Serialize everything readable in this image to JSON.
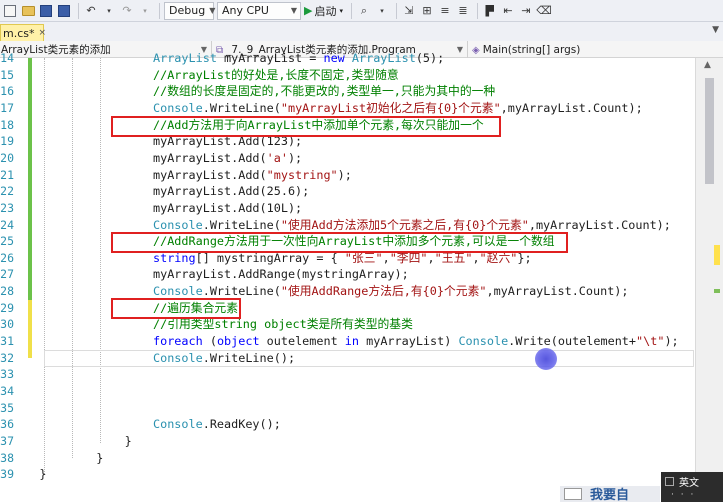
{
  "toolbar": {
    "config": "Debug",
    "platform": "Any CPU",
    "start_label": "启动"
  },
  "tab": {
    "label": "m.cs*",
    "close": "×"
  },
  "navbar": {
    "project": "ArrayList类元素的添加",
    "class": "_7._9_ArrayList类元素的添加.Program",
    "member": "Main(string[] args)"
  },
  "editor": {
    "lines": [
      {
        "num": "14",
        "indent": 5,
        "tokens": [
          {
            "t": "ArrayList",
            "c": "cls"
          },
          {
            "t": " myArrayList = ",
            "c": "def"
          },
          {
            "t": "new",
            "c": "kw"
          },
          {
            "t": " ",
            "c": "def"
          },
          {
            "t": "ArrayList",
            "c": "cls"
          },
          {
            "t": "(5);",
            "c": "def"
          }
        ]
      },
      {
        "num": "15",
        "indent": 5,
        "tokens": [
          {
            "t": "//ArrayList的好处是,长度不固定,类型随意",
            "c": "cm"
          }
        ]
      },
      {
        "num": "16",
        "indent": 5,
        "tokens": [
          {
            "t": "//数组的长度是固定的,不能更改的,类型单一,只能为其中的一种",
            "c": "cm"
          }
        ]
      },
      {
        "num": "17",
        "indent": 5,
        "tokens": [
          {
            "t": "Console",
            "c": "cls"
          },
          {
            "t": ".WriteLine(",
            "c": "def"
          },
          {
            "t": "\"myArrayList初始化之后有{0}个元素\"",
            "c": "str"
          },
          {
            "t": ",myArrayList.Count);",
            "c": "def"
          }
        ]
      },
      {
        "num": "18",
        "indent": 5,
        "tokens": [
          {
            "t": "//Add方法用于向ArrayList中添加单个元素,每次只能加一个",
            "c": "cm"
          }
        ]
      },
      {
        "num": "19",
        "indent": 5,
        "tokens": [
          {
            "t": "myArrayList.Add(123);",
            "c": "def"
          }
        ]
      },
      {
        "num": "20",
        "indent": 5,
        "tokens": [
          {
            "t": "myArrayList.Add(",
            "c": "def"
          },
          {
            "t": "'a'",
            "c": "str"
          },
          {
            "t": ");",
            "c": "def"
          }
        ]
      },
      {
        "num": "21",
        "indent": 5,
        "tokens": [
          {
            "t": "myArrayList.Add(",
            "c": "def"
          },
          {
            "t": "\"mystring\"",
            "c": "str"
          },
          {
            "t": ");",
            "c": "def"
          }
        ]
      },
      {
        "num": "22",
        "indent": 5,
        "tokens": [
          {
            "t": "myArrayList.Add(25.6);",
            "c": "def"
          }
        ]
      },
      {
        "num": "23",
        "indent": 5,
        "tokens": [
          {
            "t": "myArrayList.Add(10L);",
            "c": "def"
          }
        ]
      },
      {
        "num": "24",
        "indent": 5,
        "tokens": [
          {
            "t": "Console",
            "c": "cls"
          },
          {
            "t": ".WriteLine(",
            "c": "def"
          },
          {
            "t": "\"使用Add方法添加5个元素之后,有{0}个元素\"",
            "c": "str"
          },
          {
            "t": ",myArrayList.Count);",
            "c": "def"
          }
        ]
      },
      {
        "num": "25",
        "indent": 5,
        "tokens": [
          {
            "t": "//AddRange方法用于一次性向ArrayList中添加多个元素,可以是一个数组",
            "c": "cm"
          }
        ]
      },
      {
        "num": "26",
        "indent": 5,
        "tokens": [
          {
            "t": "string",
            "c": "kw"
          },
          {
            "t": "[] mystringArray = { ",
            "c": "def"
          },
          {
            "t": "\"张三\"",
            "c": "str"
          },
          {
            "t": ",",
            "c": "def"
          },
          {
            "t": "\"李四\"",
            "c": "str"
          },
          {
            "t": ",",
            "c": "def"
          },
          {
            "t": "\"王五\"",
            "c": "str"
          },
          {
            "t": ",",
            "c": "def"
          },
          {
            "t": "\"赵六\"",
            "c": "str"
          },
          {
            "t": "};",
            "c": "def"
          }
        ]
      },
      {
        "num": "27",
        "indent": 5,
        "tokens": [
          {
            "t": "myArrayList.AddRange(mystringArray);",
            "c": "def"
          }
        ]
      },
      {
        "num": "28",
        "indent": 5,
        "tokens": [
          {
            "t": "Console",
            "c": "cls"
          },
          {
            "t": ".WriteLine(",
            "c": "def"
          },
          {
            "t": "\"使用AddRange方法后,有{0}个元素\"",
            "c": "str"
          },
          {
            "t": ",myArrayList.Count);",
            "c": "def"
          }
        ]
      },
      {
        "num": "29",
        "indent": 5,
        "tokens": [
          {
            "t": "//遍历集合元素",
            "c": "cm"
          }
        ]
      },
      {
        "num": "30",
        "indent": 5,
        "tokens": [
          {
            "t": "//引用类型string object类是所有类型的基类",
            "c": "cm"
          }
        ]
      },
      {
        "num": "31",
        "indent": 5,
        "tokens": [
          {
            "t": "foreach",
            "c": "kw"
          },
          {
            "t": " (",
            "c": "def"
          },
          {
            "t": "object",
            "c": "kw"
          },
          {
            "t": " outelement ",
            "c": "def"
          },
          {
            "t": "in",
            "c": "kw"
          },
          {
            "t": " myArrayList) ",
            "c": "def"
          },
          {
            "t": "Console",
            "c": "cls"
          },
          {
            "t": ".Write(outelement+",
            "c": "def"
          },
          {
            "t": "\"\\t\"",
            "c": "str"
          },
          {
            "t": ");",
            "c": "def"
          }
        ]
      },
      {
        "num": "32",
        "indent": 5,
        "tokens": [
          {
            "t": "Console",
            "c": "cls"
          },
          {
            "t": ".WriteLine();",
            "c": "def"
          }
        ]
      },
      {
        "num": "33",
        "indent": 5,
        "tokens": []
      },
      {
        "num": "34",
        "indent": 5,
        "tokens": []
      },
      {
        "num": "35",
        "indent": 5,
        "tokens": []
      },
      {
        "num": "36",
        "indent": 5,
        "tokens": [
          {
            "t": "Console",
            "c": "cls"
          },
          {
            "t": ".ReadKey();",
            "c": "def"
          }
        ]
      },
      {
        "num": "37",
        "indent": 4,
        "tokens": [
          {
            "t": "}",
            "c": "def"
          }
        ]
      },
      {
        "num": "38",
        "indent": 3,
        "tokens": [
          {
            "t": "}",
            "c": "def"
          }
        ]
      },
      {
        "num": "39",
        "indent": 1,
        "tokens": [
          {
            "t": "}",
            "c": "def"
          }
        ]
      }
    ]
  },
  "ime": {
    "mode": "英文",
    "dots": "· · ·"
  },
  "watermark": {
    "text": "我要自"
  },
  "colors": {
    "comment": "#008000",
    "class": "#2b91af",
    "keyword": "#0000ff",
    "string": "#a31515",
    "highlight_box": "#e02020"
  },
  "icons": {
    "new_project": "new-project-icon",
    "open": "folder-icon",
    "save": "save-icon",
    "save_all": "save-all-icon",
    "undo": "undo-icon",
    "redo": "redo-icon",
    "start": "play-icon",
    "bookmark": "bookmark-icon"
  }
}
